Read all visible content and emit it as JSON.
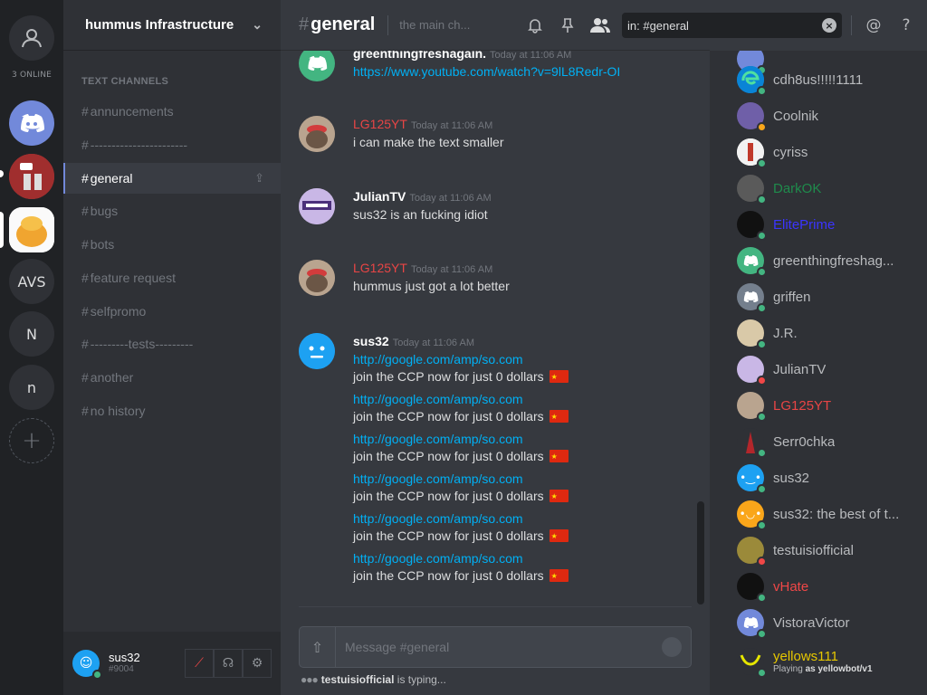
{
  "guild_rail": {
    "online_count": "3 ONLINE",
    "avs_label": "AVS",
    "n1_label": "N",
    "n2_label": "n",
    "add_label": "+"
  },
  "sidebar": {
    "server_name": "hummus Infrastructure",
    "category": "TEXT CHANNELS",
    "channels": [
      {
        "hash": "#",
        "name": "annuncements"
      },
      {
        "hash": "#",
        "name": "-----------------------"
      },
      {
        "hash": "#",
        "name": "general"
      },
      {
        "hash": "#",
        "name": "bugs"
      },
      {
        "hash": "#",
        "name": "bots"
      },
      {
        "hash": "#",
        "name": "feature request"
      },
      {
        "hash": "#",
        "name": "selfpromo"
      },
      {
        "hash": "#",
        "name": "---------tests---------"
      },
      {
        "hash": "#",
        "name": "another"
      },
      {
        "hash": "#",
        "name": "no history"
      }
    ]
  },
  "user_panel": {
    "username": "sus32",
    "tag": "#9004"
  },
  "chat": {
    "channel_hash": "#",
    "channel_name": "general",
    "topic": "the main ch...",
    "search_value": "in: #general",
    "composer_placeholder": "Message #general",
    "typing_user": "testuisiofficial",
    "typing_suffix": "is typing...",
    "messages": [
      {
        "author": "greenthingfreshagain.",
        "timestamp": "Today at 11:06 AM",
        "lines": [
          "https://www.youtube.com/watch?v=9lL8Redr-OI"
        ]
      },
      {
        "author": "LG125YT",
        "timestamp": "Today at 11:06 AM",
        "lines": [
          "i can make the text smaller"
        ]
      },
      {
        "author": "JulianTV",
        "timestamp": "Today at 11:06 AM",
        "lines": [
          "sus32 is an fucking idiot"
        ]
      },
      {
        "author": "LG125YT",
        "timestamp": "Today at 11:06 AM",
        "lines": [
          "hummus just got a lot better"
        ]
      },
      {
        "author": "sus32",
        "timestamp": "Today at 11:06 AM",
        "pairs": [
          {
            "link": "http://google.com/amp/so.com",
            "text": "join the CCP now for just 0 dollars"
          },
          {
            "link": "http://google.com/amp/so.com",
            "text": "join the CCP now for just 0 dollars"
          },
          {
            "link": "http://google.com/amp/so.com",
            "text": "join the CCP now for just 0 dollars"
          },
          {
            "link": "http://google.com/amp/so.com",
            "text": "join the CCP now for just 0 dollars"
          },
          {
            "link": "http://google.com/amp/so.com",
            "text": "join the CCP now for just 0 dollars"
          },
          {
            "link": "http://google.com/amp/so.com",
            "text": "join the CCP now for just 0 dollars"
          }
        ]
      }
    ]
  },
  "members": [
    {
      "name": "cdh8us!!!!!1111",
      "status": "online",
      "color": "#b9bbbe"
    },
    {
      "name": "Coolnik",
      "status": "idle",
      "color": "#b9bbbe"
    },
    {
      "name": "cyriss",
      "status": "online",
      "color": "#b9bbbe"
    },
    {
      "name": "DarkOK",
      "status": "online",
      "color": "#1f8b4c"
    },
    {
      "name": "ElitePrime",
      "status": "online",
      "color": "#3b34ff"
    },
    {
      "name": "greenthingfreshag...",
      "status": "online",
      "color": "#b9bbbe"
    },
    {
      "name": "griffen",
      "status": "online",
      "color": "#b9bbbe"
    },
    {
      "name": "J.R.",
      "status": "online",
      "color": "#b9bbbe"
    },
    {
      "name": "JulianTV",
      "status": "dnd",
      "color": "#b9bbbe"
    },
    {
      "name": "LG125YT",
      "status": "online",
      "color": "#e84545"
    },
    {
      "name": "Serr0chka",
      "status": "online",
      "color": "#b9bbbe"
    },
    {
      "name": "sus32",
      "status": "online",
      "color": "#b9bbbe"
    },
    {
      "name": "sus32: the best of t...",
      "status": "online",
      "color": "#b9bbbe"
    },
    {
      "name": "testuisiofficial",
      "status": "dnd",
      "color": "#b9bbbe"
    },
    {
      "name": "vHate",
      "status": "online",
      "color": "#f04747"
    },
    {
      "name": "VistoraVictor",
      "status": "online",
      "color": "#b9bbbe"
    },
    {
      "name": "yellows111",
      "status": "online",
      "color": "#e6c700",
      "sub_prefix": "Playing",
      "sub_game": "as yellowbot/v1"
    }
  ],
  "colors": {
    "accent": "#7289da",
    "link": "#00b0f4",
    "online": "#43b581",
    "idle": "#faa61a",
    "dnd": "#f04747"
  }
}
